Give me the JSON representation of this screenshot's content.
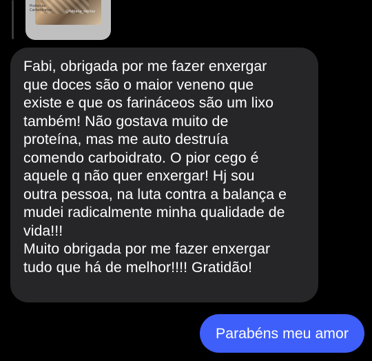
{
  "story_reply": {
    "thumbnail_icon": "story-thumbnail-image",
    "caption_lines": [
      "Proteínas",
      "Carboidratos",
      "@fabiana_dantas"
    ]
  },
  "incoming_message": {
    "text": "Fabi, obrigada por me fazer enxergar\nque doces são o maior veneno que\nexiste e que os  farináceos são um lixo\ntambém! Não gostava muito de\nproteína, mas me auto destruía\ncomendo carboidrato. O pior cego é\naquele q não quer enxergar! Hj sou\noutra pessoa, na luta contra a balança e\nmudei radicalmente minha qualidade de\nvida!!!\nMuito obrigada por me fazer enxergar\ntudo que há de melhor!!!! Gratidão!"
  },
  "outgoing_message": {
    "text": "Parabéns meu amor"
  },
  "colors": {
    "background": "#000000",
    "incoming_bubble": "#262628",
    "outgoing_bubble": "#3f5ffb",
    "text": "#ffffff"
  }
}
